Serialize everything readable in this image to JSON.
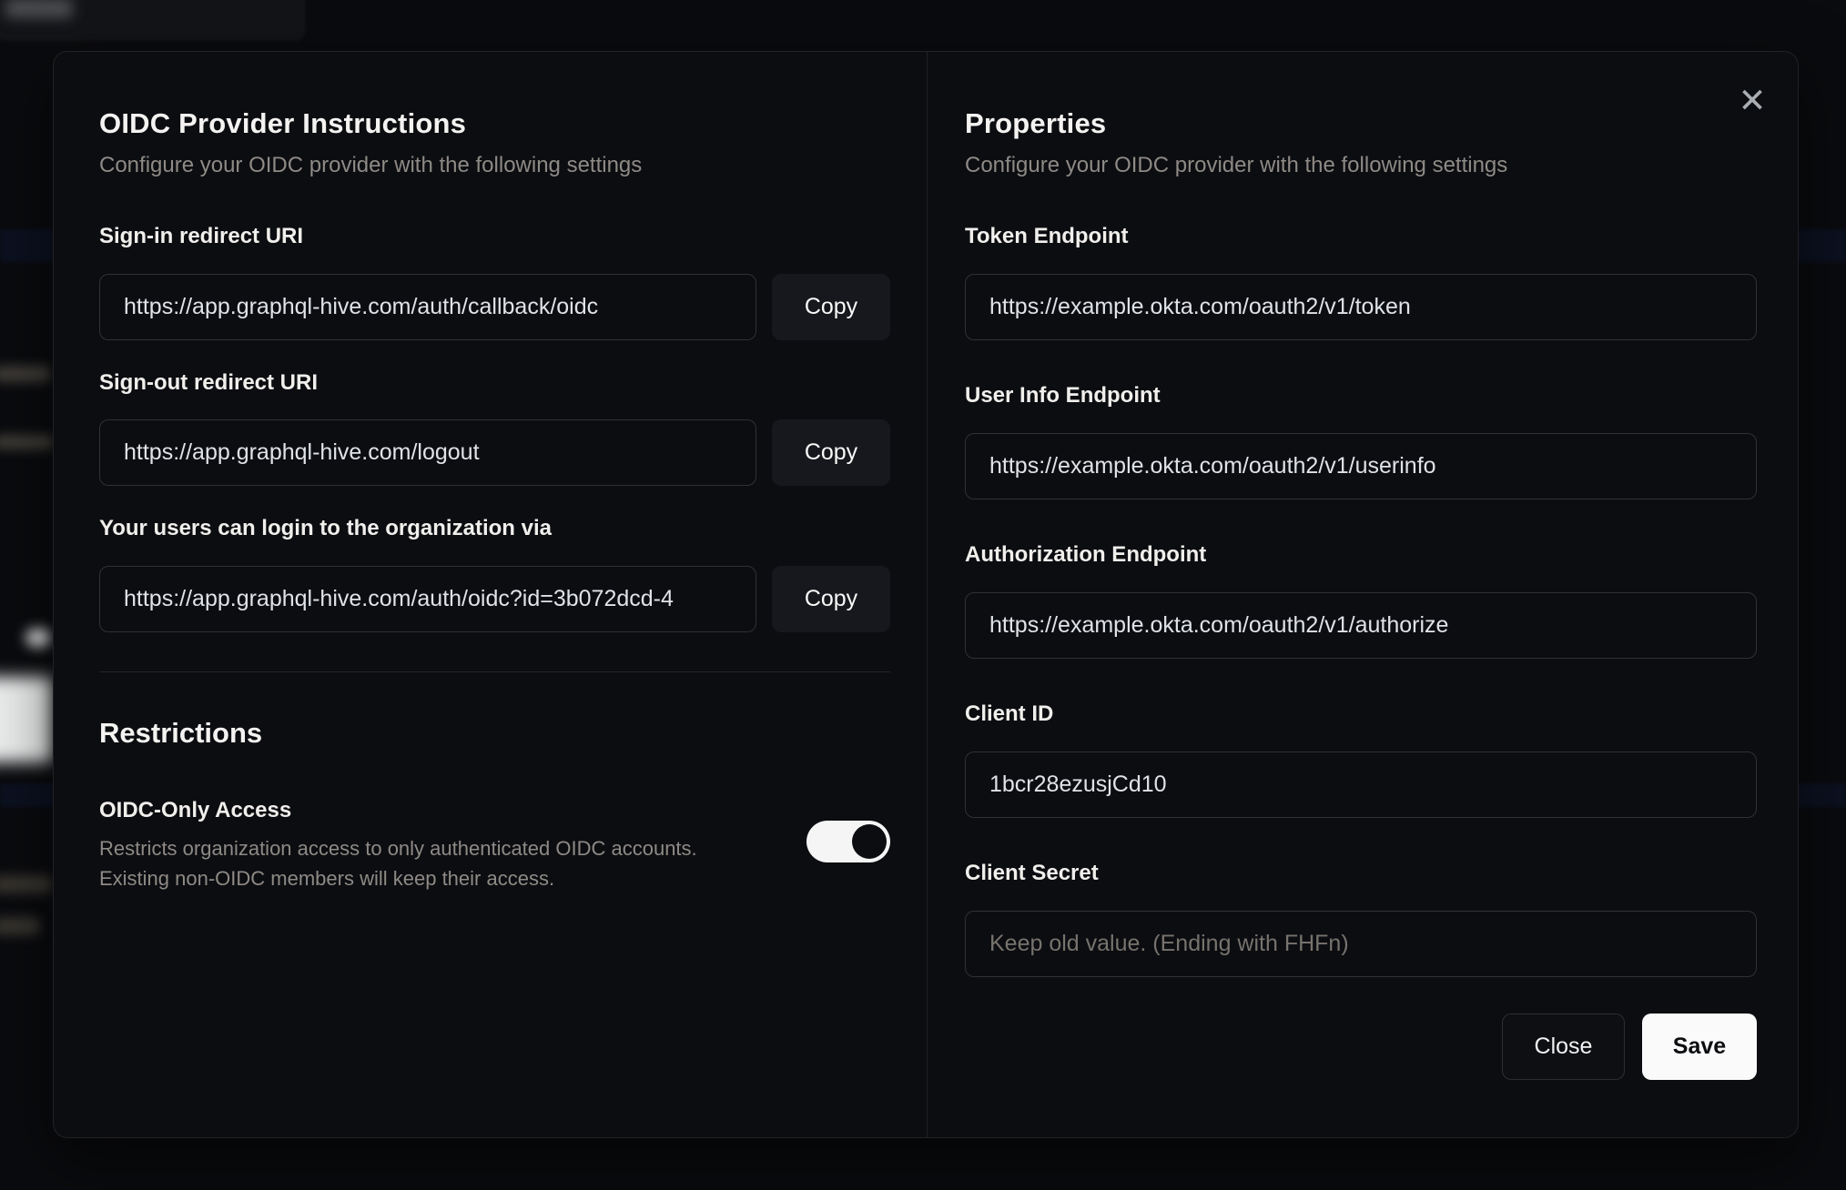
{
  "modal": {
    "close_icon": "✕",
    "left_panel": {
      "title": "OIDC Provider Instructions",
      "subtitle": "Configure your OIDC provider with the following settings",
      "fields": [
        {
          "label": "Sign-in redirect URI",
          "value": "https://app.graphql-hive.com/auth/callback/oidc",
          "copy_label": "Copy"
        },
        {
          "label": "Sign-out redirect URI",
          "value": "https://app.graphql-hive.com/logout",
          "copy_label": "Copy"
        },
        {
          "label": "Your users can login to the organization via",
          "value": "https://app.graphql-hive.com/auth/oidc?id=3b072dcd-4",
          "copy_label": "Copy"
        }
      ],
      "restrictions": {
        "title": "Restrictions",
        "toggle_label": "OIDC-Only Access",
        "toggle_description_line1": "Restricts organization access to only authenticated OIDC accounts.",
        "toggle_description_line2": "Existing non-OIDC members will keep their access.",
        "toggle_state": "on"
      }
    },
    "right_panel": {
      "title": "Properties",
      "subtitle": "Configure your OIDC provider with the following settings",
      "fields": [
        {
          "label": "Token Endpoint",
          "value": "https://example.okta.com/oauth2/v1/token"
        },
        {
          "label": "User Info Endpoint",
          "value": "https://example.okta.com/oauth2/v1/userinfo"
        },
        {
          "label": "Authorization Endpoint",
          "value": "https://example.okta.com/oauth2/v1/authorize"
        },
        {
          "label": "Client ID",
          "value": "1bcr28ezusjCd10"
        },
        {
          "label": "Client Secret",
          "value": "",
          "placeholder": "Keep old value. (Ending with FHFn)"
        }
      ],
      "close_label": "Close",
      "save_label": "Save"
    }
  },
  "colors": {
    "modal_background": "#0c0d11",
    "accent_white": "#fafafa",
    "muted_text": "#8e8a85",
    "input_border": "rgba(255,255,255,0.15)"
  }
}
